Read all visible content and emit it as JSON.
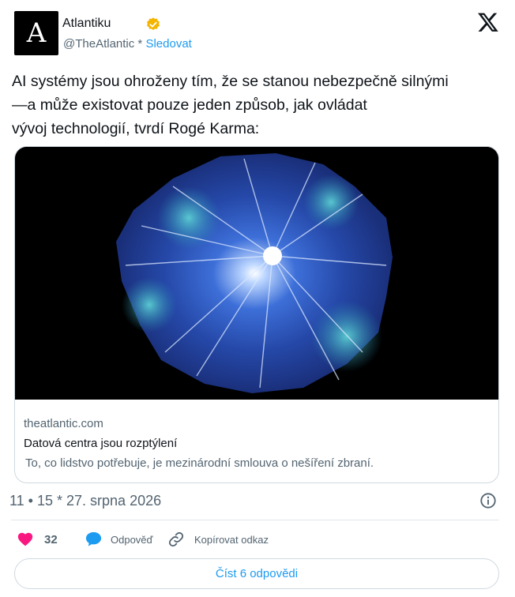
{
  "author": {
    "avatar_letter": "A",
    "name": "Atlantiku",
    "handle": "@TheAtlantic",
    "separator": " * ",
    "follow_label": "Sledovat",
    "verified_icon": "verified-badge-icon",
    "verified_color": "#f4b400"
  },
  "platform_logo": "x-logo-icon",
  "tweet": {
    "lines": [
      "AI systémy jsou ohroženy tím, že se stanou nebezpečně silnými",
      "—a může existovat pouze jeden způsob, jak ovládat",
      "vývoj technologií, tvrdí Rogé Karma:"
    ]
  },
  "card": {
    "image": "abstract-blue-data-burst",
    "domain": "theatlantic.com",
    "title": "Datová centra jsou rozptýlení",
    "description": "To, co lidstvo potřebuje, je mezinárodní smlouva o nešíření zbraní."
  },
  "meta": {
    "timestamp": "11 • 15 * 27. srpna 2026",
    "info_icon": "info-icon"
  },
  "actions": {
    "like_count": "32",
    "reply_label": "Odpověď",
    "copy_link_label": "Kopírovat odkaz",
    "like_color": "#f91880",
    "accent_color": "#1d9bf0"
  },
  "read_replies_label": "Číst 6 odpovědi"
}
